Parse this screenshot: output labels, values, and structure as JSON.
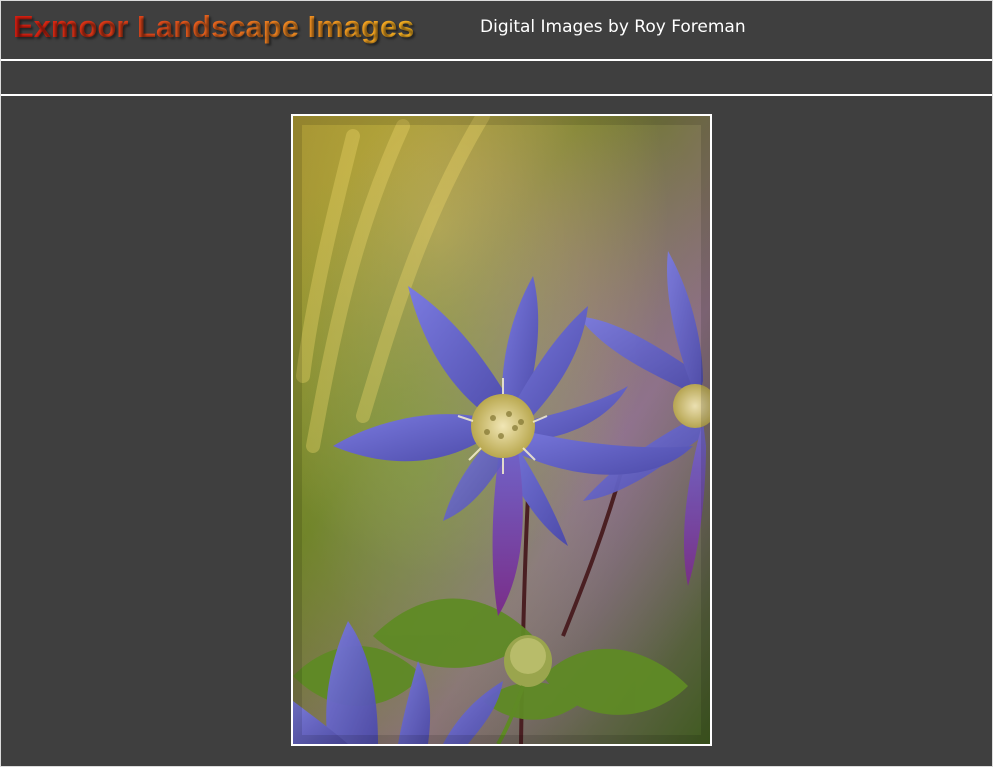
{
  "header": {
    "title": "Exmoor Landscape Images",
    "subtitle": "Digital Images by Roy Foreman"
  },
  "nav": {
    "items": []
  },
  "photo": {
    "subject": "flower-photo",
    "colors": {
      "petal": "#6f6fcf",
      "petal_dark": "#4b4aa8",
      "center": "#e2d39a",
      "leaf": "#5f8a25",
      "background_top": "#8a8a2a",
      "background_mid": "#6a7a26",
      "frame": "#ffffff"
    }
  },
  "colors": {
    "page_background": "#3f3f3f",
    "title_gradient_start": "#d81c10",
    "title_gradient_end": "#f6b321",
    "subtitle_text": "#ffffff",
    "divider": "#ffffff"
  }
}
